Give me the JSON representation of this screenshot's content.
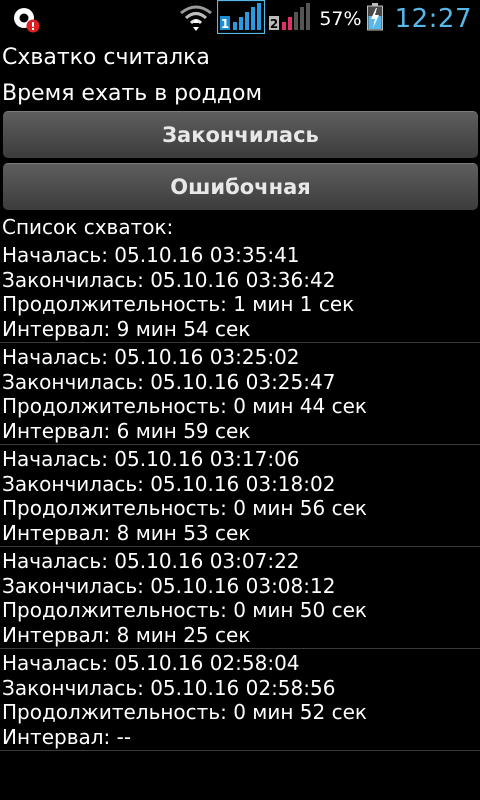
{
  "status_bar": {
    "battery_percent": "57%",
    "time": "12:27",
    "sim1_label": "1",
    "sim2_label": "2"
  },
  "app": {
    "title": "Схватко считалка",
    "message": "Время ехать в роддом"
  },
  "buttons": {
    "finished_label": "Закончилась",
    "false_label": "Ошибочная"
  },
  "list": {
    "header": "Список схваток:",
    "items": [
      {
        "started": "Началась: 05.10.16 03:35:41",
        "ended": "Закончилась: 05.10.16 03:36:42",
        "duration": "Продолжительность: 1 мин 1 сек",
        "interval": "Интервал: 9 мин 54 сек"
      },
      {
        "started": "Началась: 05.10.16 03:25:02",
        "ended": "Закончилась: 05.10.16 03:25:47",
        "duration": "Продолжительность: 0 мин 44 сек",
        "interval": "Интервал: 6 мин 59 сек"
      },
      {
        "started": "Началась: 05.10.16 03:17:06",
        "ended": "Закончилась: 05.10.16 03:18:02",
        "duration": "Продолжительность: 0 мин 56 сек",
        "interval": "Интервал: 8 мин 53 сек"
      },
      {
        "started": "Началась: 05.10.16 03:07:22",
        "ended": "Закончилась: 05.10.16 03:08:12",
        "duration": "Продолжительность: 0 мин 50 сек",
        "interval": "Интервал: 8 мин 25 сек"
      },
      {
        "started": "Началась: 05.10.16 02:58:04",
        "ended": "Закончилась: 05.10.16 02:58:56",
        "duration": "Продолжительность: 0 мин 52 сек",
        "interval": "Интервал: --"
      }
    ]
  }
}
